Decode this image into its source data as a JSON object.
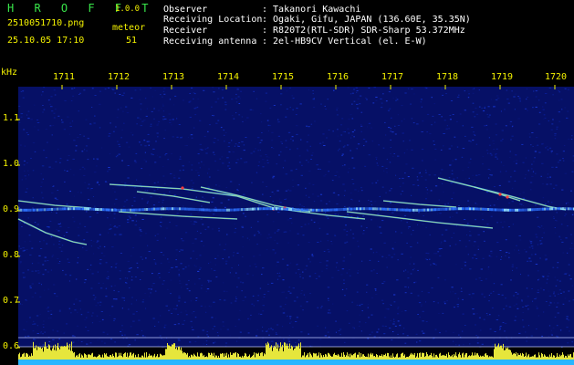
{
  "header": {
    "app_title": "H R O F F T",
    "version": "1.0.0",
    "filename": "2510051710.png",
    "meteor_label": "meteor",
    "datetime": "25.10.05 17:10",
    "meteor_count": "51"
  },
  "info": {
    "observer_label": "Observer",
    "observer_value": ": Takanori Kawachi",
    "location_label": "Receiving Location",
    "location_value": ": Ogaki, Gifu, JAPAN (136.60E, 35.35N)",
    "receiver_label": "Receiver",
    "receiver_value": ": R820T2(RTL-SDR) SDR-Sharp 53.372MHz",
    "antenna_label": "Receiving antenna",
    "antenna_value": ": 2el-HB9CV Vertical (el. E-W)"
  },
  "axes": {
    "y_unit": "kHz",
    "y_ticks": [
      "1.1",
      "1.0",
      "0.9",
      "0.8",
      "0.7",
      "0.6"
    ],
    "x_ticks": [
      "1711",
      "1712",
      "1713",
      "1714",
      "1715",
      "1716",
      "1717",
      "1718",
      "1719",
      "1720"
    ]
  },
  "colors": {
    "accent_text": "#f4f200",
    "title_text": "#39e64a",
    "background_noise": "#0a1a8a",
    "signal_hot": "#ff3b3b",
    "power_bar": "#e6e63c",
    "baseline": "#27b6ff"
  }
}
